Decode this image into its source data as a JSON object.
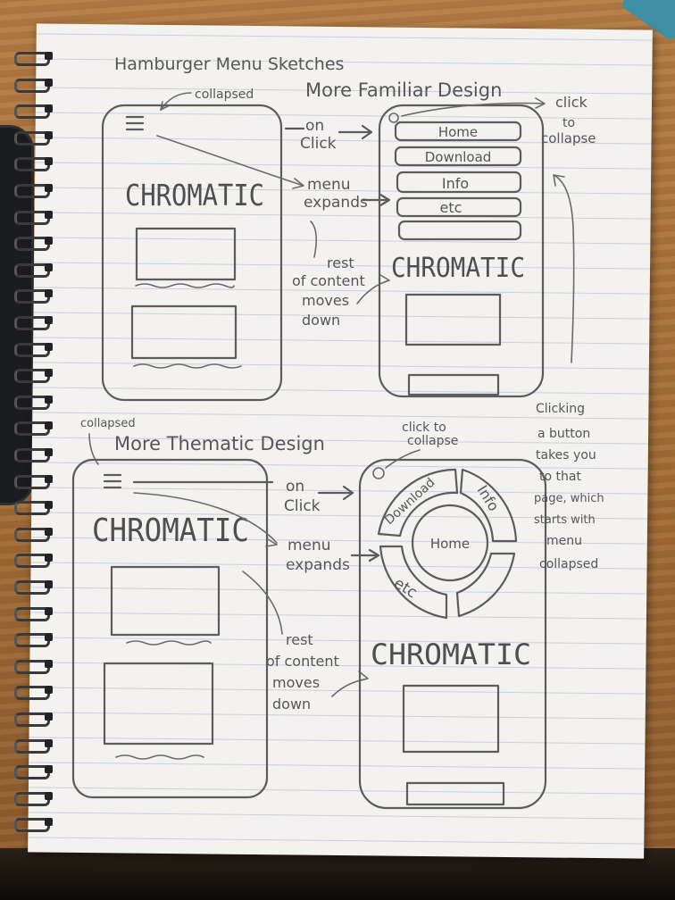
{
  "title": "Hamburger Menu Sketches",
  "familiar": {
    "heading": "More Familiar Design",
    "collapsed_label": "collapsed",
    "brand": "CHROMATIC",
    "on_click_1": "on",
    "on_click_2": "Click",
    "menu_expands_1": "menu",
    "menu_expands_2": "expands",
    "rest_1": "rest",
    "rest_2": "of content",
    "rest_3": "moves",
    "rest_4": "down",
    "click_collapse_1": "click",
    "click_collapse_2": "to",
    "click_collapse_3": "collapse",
    "menu_items": [
      "Home",
      "Download",
      "Info",
      "etc"
    ]
  },
  "thematic": {
    "heading": "More Thematic Design",
    "collapsed_label": "collapsed",
    "brand": "CHROMATIC",
    "on_click_1": "on",
    "on_click_2": "Click",
    "menu_expands_1": "menu",
    "menu_expands_2": "expands",
    "rest_1": "rest",
    "rest_2": "of content",
    "rest_3": "moves",
    "rest_4": "down",
    "click_collapse_1": "click to",
    "click_collapse_2": "collapse",
    "ring_download": "Download",
    "ring_info": "Info",
    "ring_home": "Home",
    "ring_etc": "etc",
    "note_lines": [
      "Clicking",
      "a button",
      "takes you",
      "to that",
      "page, which",
      "starts with",
      "menu",
      "collapsed"
    ]
  },
  "colors": {
    "pencil": "#5c5c5e",
    "paper": "#f3f2ef",
    "desk": "#a8733f"
  }
}
